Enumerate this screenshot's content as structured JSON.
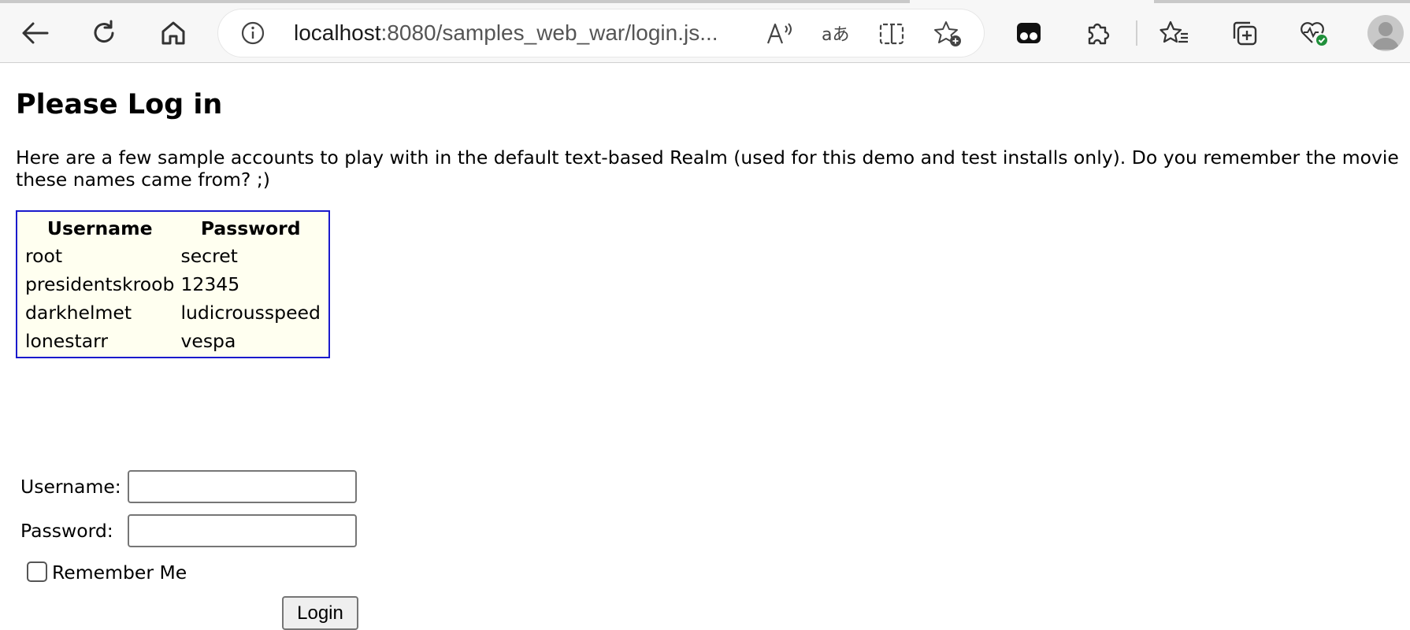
{
  "browser": {
    "url_host": "localhost",
    "url_path": ":8080/samples_web_war/login.js...",
    "icons": {
      "back": "back-arrow-icon",
      "refresh": "refresh-icon",
      "home": "home-icon",
      "site_info": "info-icon",
      "read_aloud": "read-aloud-icon",
      "translate": "translate-icon",
      "split_screen": "split-screen-icon",
      "add_favorite": "add-favorite-icon",
      "extension_app": "extension-app-icon",
      "extensions": "puzzle-icon",
      "favorites": "favorites-icon",
      "collections": "collections-icon",
      "browser_essentials": "health-heart-icon",
      "profile": "profile-avatar-icon"
    }
  },
  "page": {
    "title": "Please Log in",
    "intro": "Here are a few sample accounts to play with in the default text-based Realm (used for this demo and test installs only). Do you remember the movie these names came from? ;)",
    "accounts_table": {
      "headers": [
        "Username",
        "Password"
      ],
      "rows": [
        [
          "root",
          "secret"
        ],
        [
          "presidentskroob",
          "12345"
        ],
        [
          "darkhelmet",
          "ludicrousspeed"
        ],
        [
          "lonestarr",
          "vespa"
        ]
      ],
      "border_color": "#1a1acc",
      "background_color": "#fffff0"
    },
    "form": {
      "username_label": "Username:",
      "username_value": "",
      "password_label": "Password:",
      "password_value": "",
      "remember_me_label": "Remember Me",
      "remember_me_checked": false,
      "login_button_label": "Login"
    }
  }
}
